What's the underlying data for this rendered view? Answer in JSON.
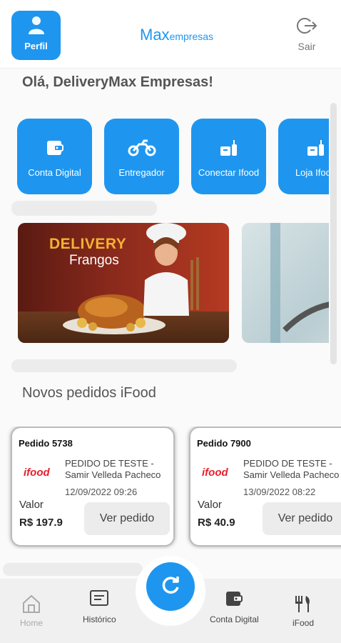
{
  "colors": {
    "accent": "#1e96f0",
    "ifood_red": "#ea1d2c"
  },
  "header": {
    "profile_label": "Perfil",
    "logo_main": "Max",
    "logo_sub": "empresas",
    "exit_label": "Sair"
  },
  "greeting": "Olá, DeliveryMax Empresas!",
  "quick_actions": [
    {
      "label": "Conta Digital",
      "icon": "wallet-icon"
    },
    {
      "label": "Entregador",
      "icon": "motorcycle-icon"
    },
    {
      "label": "Conectar Ifood",
      "icon": "food-icon"
    },
    {
      "label": "Loja Ifood",
      "icon": "food-icon"
    }
  ],
  "banners": [
    {
      "title": "DELIVERY",
      "subtitle": "Frangos"
    },
    {
      "title": "",
      "subtitle": ""
    }
  ],
  "orders_section_title": "Novos pedidos iFood",
  "orders": [
    {
      "id": "Pedido 5738",
      "logo": "ifood",
      "name1": "PEDIDO DE TESTE -",
      "name2": "Samir Velleda Pacheco",
      "date": "12/09/2022  09:26",
      "value_label": "Valor",
      "amount": "R$ 197.9",
      "button": "Ver pedido"
    },
    {
      "id": "Pedido 7900",
      "logo": "ifood",
      "name1": "PEDIDO DE TESTE -",
      "name2": "Samir Velleda Pacheco",
      "date": "13/09/2022  08:22",
      "value_label": "Valor",
      "amount": "R$ 40.9",
      "button": "Ver pedido"
    }
  ],
  "bottom_nav": {
    "home": "Home",
    "history": "Histórico",
    "wallet": "Conta Digital",
    "ifood": "iFood",
    "refresh_icon": "refresh-icon"
  }
}
